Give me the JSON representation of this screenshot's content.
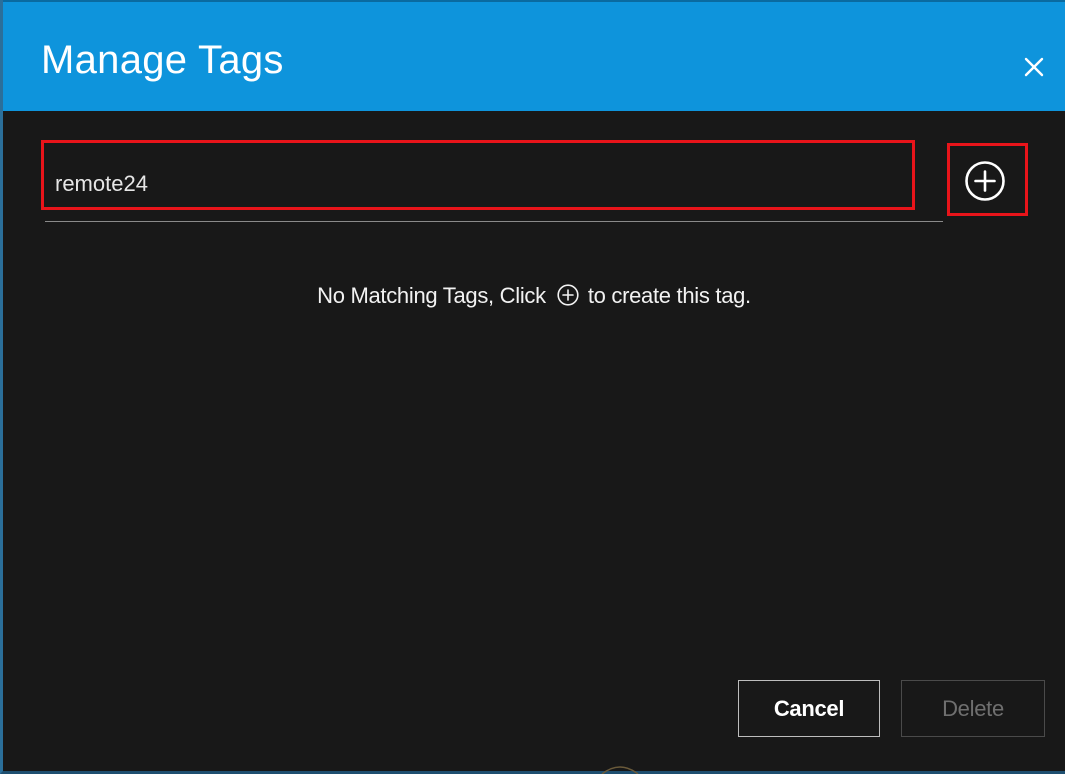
{
  "dialog": {
    "title": "Manage Tags",
    "close_icon": "close-icon"
  },
  "tag_input": {
    "value": "remote24",
    "placeholder": ""
  },
  "add_button": {
    "icon": "plus-circle-icon"
  },
  "message": {
    "before_icon": "No Matching Tags, Click",
    "icon": "plus-circle-icon",
    "after_icon": "to create this tag."
  },
  "footer": {
    "cancel_label": "Cancel",
    "delete_label": "Delete"
  },
  "colors": {
    "header_bg": "#0e94dc",
    "body_bg": "#181818",
    "highlight": "#e8141a",
    "disabled_text": "#6f6f6f"
  }
}
